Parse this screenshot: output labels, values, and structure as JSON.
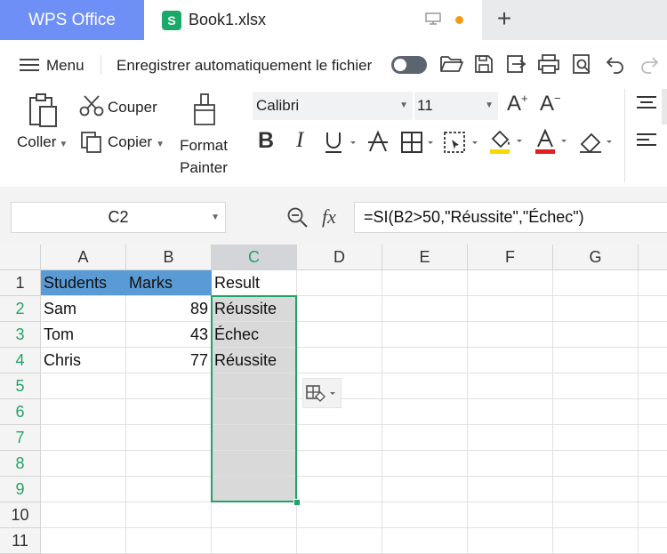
{
  "tabs": {
    "home_label": "WPS Office",
    "doc_icon_letter": "S",
    "doc_title": "Book1.xlsx",
    "new_tab_symbol": "+"
  },
  "menu": {
    "menu_label": "Menu",
    "autosave_label": "Enregistrer automatiquement le fichier"
  },
  "ribbon": {
    "paste_label": "Coller",
    "cut_label": "Couper",
    "copy_label": "Copier",
    "format_painter_line1": "Format",
    "format_painter_line2": "Painter",
    "font_name": "Calibri",
    "font_size": "11",
    "bold_glyph": "B",
    "italic_glyph": "I"
  },
  "formula_bar": {
    "name_box": "C2",
    "fx_label": "fx",
    "formula": "=SI(B2>50,\"Réussite\",\"Échec\")"
  },
  "sheet": {
    "columns": [
      "A",
      "B",
      "C",
      "D",
      "E",
      "F",
      "G"
    ],
    "rows": [
      "1",
      "2",
      "3",
      "4",
      "5",
      "6",
      "7",
      "8",
      "9",
      "10",
      "11"
    ],
    "data": [
      [
        "Students",
        "Marks",
        "Result"
      ],
      [
        "Sam",
        "89",
        "Réussite"
      ],
      [
        "Tom",
        "43",
        "Échec"
      ],
      [
        "Chris",
        "77",
        "Réussite"
      ]
    ]
  },
  "colors": {
    "accent_tab": "#6e8ff6",
    "header_fill": "#5b9bd5",
    "selection_border": "#21a366",
    "selected_fill": "#d9d9d9",
    "font_color_bar": "#e02020",
    "highlight_bar": "#f5d800"
  }
}
